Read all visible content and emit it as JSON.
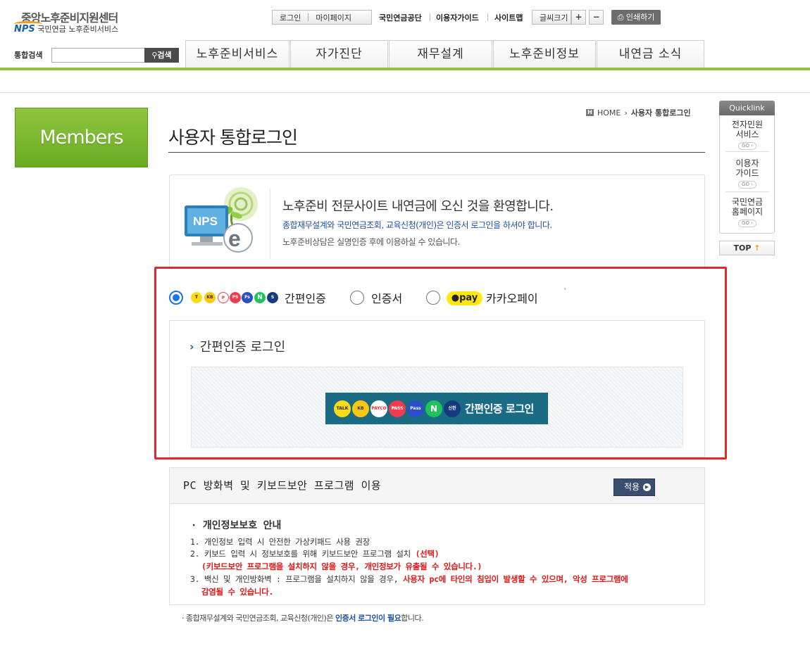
{
  "header": {
    "logo_line1": "중앙노후준비지원센터",
    "logo_nps": "NPS",
    "logo_line2": "국민연금 노후준비서비스",
    "login": "로그인",
    "mypage": "마이페이지",
    "nps_link": "국민연금공단",
    "guide": "이용자가이드",
    "sitemap": "사이트맵",
    "font_size": "글씨크기",
    "font_plus": "+",
    "font_minus": "−",
    "print": "인쇄하기"
  },
  "search": {
    "label": "통합검색",
    "placeholder": "",
    "button": "검색"
  },
  "gnb": [
    {
      "label": "노후준비서비스"
    },
    {
      "label": "자가진단"
    },
    {
      "label": "재무설계"
    },
    {
      "label": "노후준비정보"
    },
    {
      "label": "내연금 소식"
    }
  ],
  "left": {
    "members": "Members"
  },
  "breadcrumb": {
    "home": "HOME",
    "current": "사용자 통합로그인"
  },
  "page_title": "사용자 통합로그인",
  "welcome": {
    "title": "노후준비 전문사이트 내연금에 오신 것을 환영합니다.",
    "notice_blue": "종합재무설계와 국민연금조회, 교육신청(개인)은 인증서 로그인을 하셔야 합니다.",
    "notice_gray": "노후준비상담은 실명인증 후에 이용하실 수 있습니다."
  },
  "auth_options": {
    "simple": "간편인증",
    "cert": "인증서",
    "kakao": "카카오페이",
    "kakao_badge": "pay",
    "selected": "simple",
    "tick": "`"
  },
  "simple_login": {
    "heading": "간편인증 로그인",
    "button": "간편인증 로그인",
    "icons": [
      "TALK",
      "KB",
      "PAYCO",
      "PASS",
      "Pass",
      "N",
      "신한"
    ]
  },
  "pc_security": {
    "title": "PC 방화벽 및 키보드보안 프로그램 이용",
    "apply": "적용",
    "privacy_title": "· 개인정보보호 안내",
    "line1": "1. 개인정보 입력 시 안전한 가상키패드 사용 권장",
    "line2_a": "2. 키보드 입력 시 정보보호를 위해 키보드보안 프로그램 설치 ",
    "line2_b": "(선택)",
    "line2_c": "(키보드보안 프로그램을 설치하지 않을 경우, 개인정보가 유출될 수 있습니다.)",
    "line3_a": "3. 백신 및 개인방화벽 : 프로그램을 설치하지 않을 경우, ",
    "line3_b": "사용자 pc에 타인의 침입이 발생할 수 있으며, 악성 프로그램에",
    "line3_c": "감염될 수 있습니다."
  },
  "footnote": {
    "text_a": "· 종합재무설계와 국민연금조회, 교육신청(개인)은 ",
    "text_b": "인증서 로그인이 필요",
    "text_c": "합니다."
  },
  "quicklink": {
    "title": "Quicklink",
    "items": [
      {
        "label1": "전자민원",
        "label2": "서비스",
        "go": "GO ›"
      },
      {
        "label1": "이용자",
        "label2": "가이드",
        "go": "GO ›"
      },
      {
        "label1": "국민연금",
        "label2": "홈페이지",
        "go": "GO ›"
      }
    ],
    "top": "TOP",
    "top_arrow": "↑"
  },
  "colors": {
    "green": "#8dc33f",
    "highlight_red": "#e3262e",
    "login_button": "#1a6b84",
    "navy": "#1d4f9f"
  }
}
